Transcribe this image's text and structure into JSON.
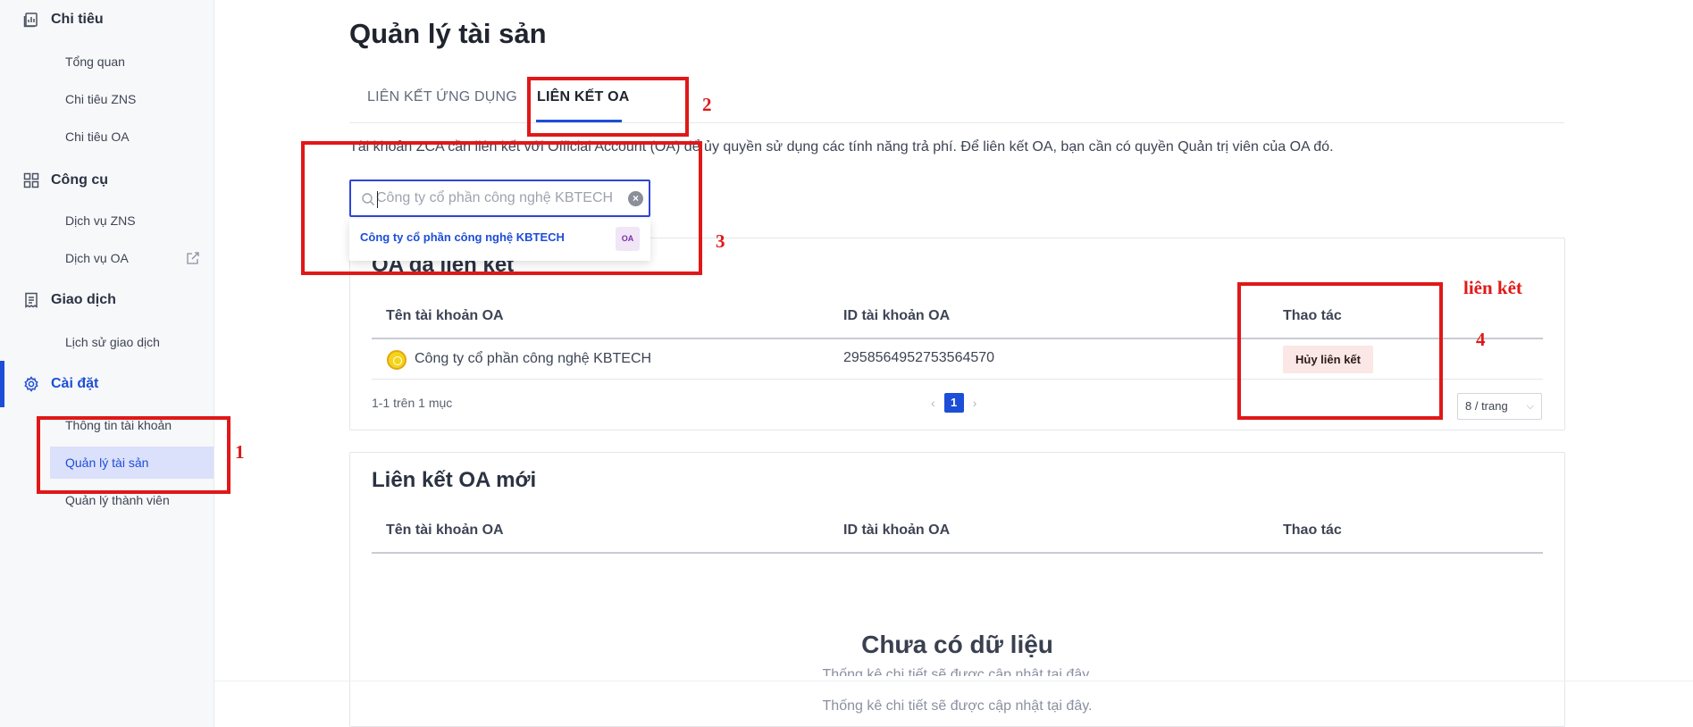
{
  "sidebar": {
    "groups": [
      {
        "label": "Chi tiêu",
        "icon": "report-icon"
      },
      {
        "label": "Công cụ",
        "icon": "grid-icon"
      },
      {
        "label": "Giao dịch",
        "icon": "receipt-icon"
      },
      {
        "label": "Cài đặt",
        "icon": "gear-icon"
      }
    ],
    "items": [
      {
        "label": "Tổng quan"
      },
      {
        "label": "Chi tiêu ZNS"
      },
      {
        "label": "Chi tiêu OA"
      },
      {
        "label": "Dịch vụ ZNS"
      },
      {
        "label": "Dịch vụ OA"
      },
      {
        "label": "Lịch sử giao dịch"
      },
      {
        "label": "Thông tin tài khoản"
      },
      {
        "label": "Quản lý tài sản"
      },
      {
        "label": "Quản lý thành viên"
      }
    ],
    "active_group": "Cài đặt",
    "selected_item": "Quản lý tài sản"
  },
  "page": {
    "title": "Quản lý tài sản",
    "tabs": [
      {
        "label": "LIÊN KẾT ỨNG DỤNG",
        "active": false
      },
      {
        "label": "LIÊN KẾT OA",
        "active": true
      }
    ],
    "description": "Tài khoản ZCA cần liên kết với Official Account (OA) để ủy quyền sử dụng các tính năng trả phí. Để liên kết OA, bạn cần có quyền Quản trị viên của OA đó."
  },
  "search": {
    "value": "Công ty cổ phần công nghệ KBTECH",
    "clear_glyph": "×",
    "suggestion": "Công ty cổ phần công nghệ KBTECH",
    "suggestion_badge": "OA"
  },
  "linked_card": {
    "title": "OA đã liên kết",
    "columns": [
      "Tên tài khoản OA",
      "ID tài khoản OA",
      "Thao tác"
    ],
    "rows": [
      {
        "name": "Công ty cổ phần công nghệ KBTECH",
        "id": "2958564952753564570",
        "action": "Hủy liên kết"
      }
    ],
    "count_text": "1-1 trên 1 mục",
    "prev_glyph": "‹",
    "next_glyph": "›",
    "current_page": "1",
    "page_size": "8 / trang",
    "page_size_glyph": "⌵"
  },
  "new_card": {
    "title": "Liên kết OA mới",
    "columns": [
      "Tên tài khoản OA",
      "ID tài khoản OA",
      "Thao tác"
    ],
    "empty_title": "Chưa có dữ liệu",
    "empty_sub": "Thống kê chi tiết sẽ được cập nhật tại đây."
  },
  "annotations": {
    "n1": "1",
    "n2": "2",
    "n3": "3",
    "n4": "4",
    "note": "liên kêt"
  },
  "colors": {
    "accent": "#1d4ed8",
    "annotation": "#e01818",
    "unlink_bg": "#fbe7e6"
  }
}
